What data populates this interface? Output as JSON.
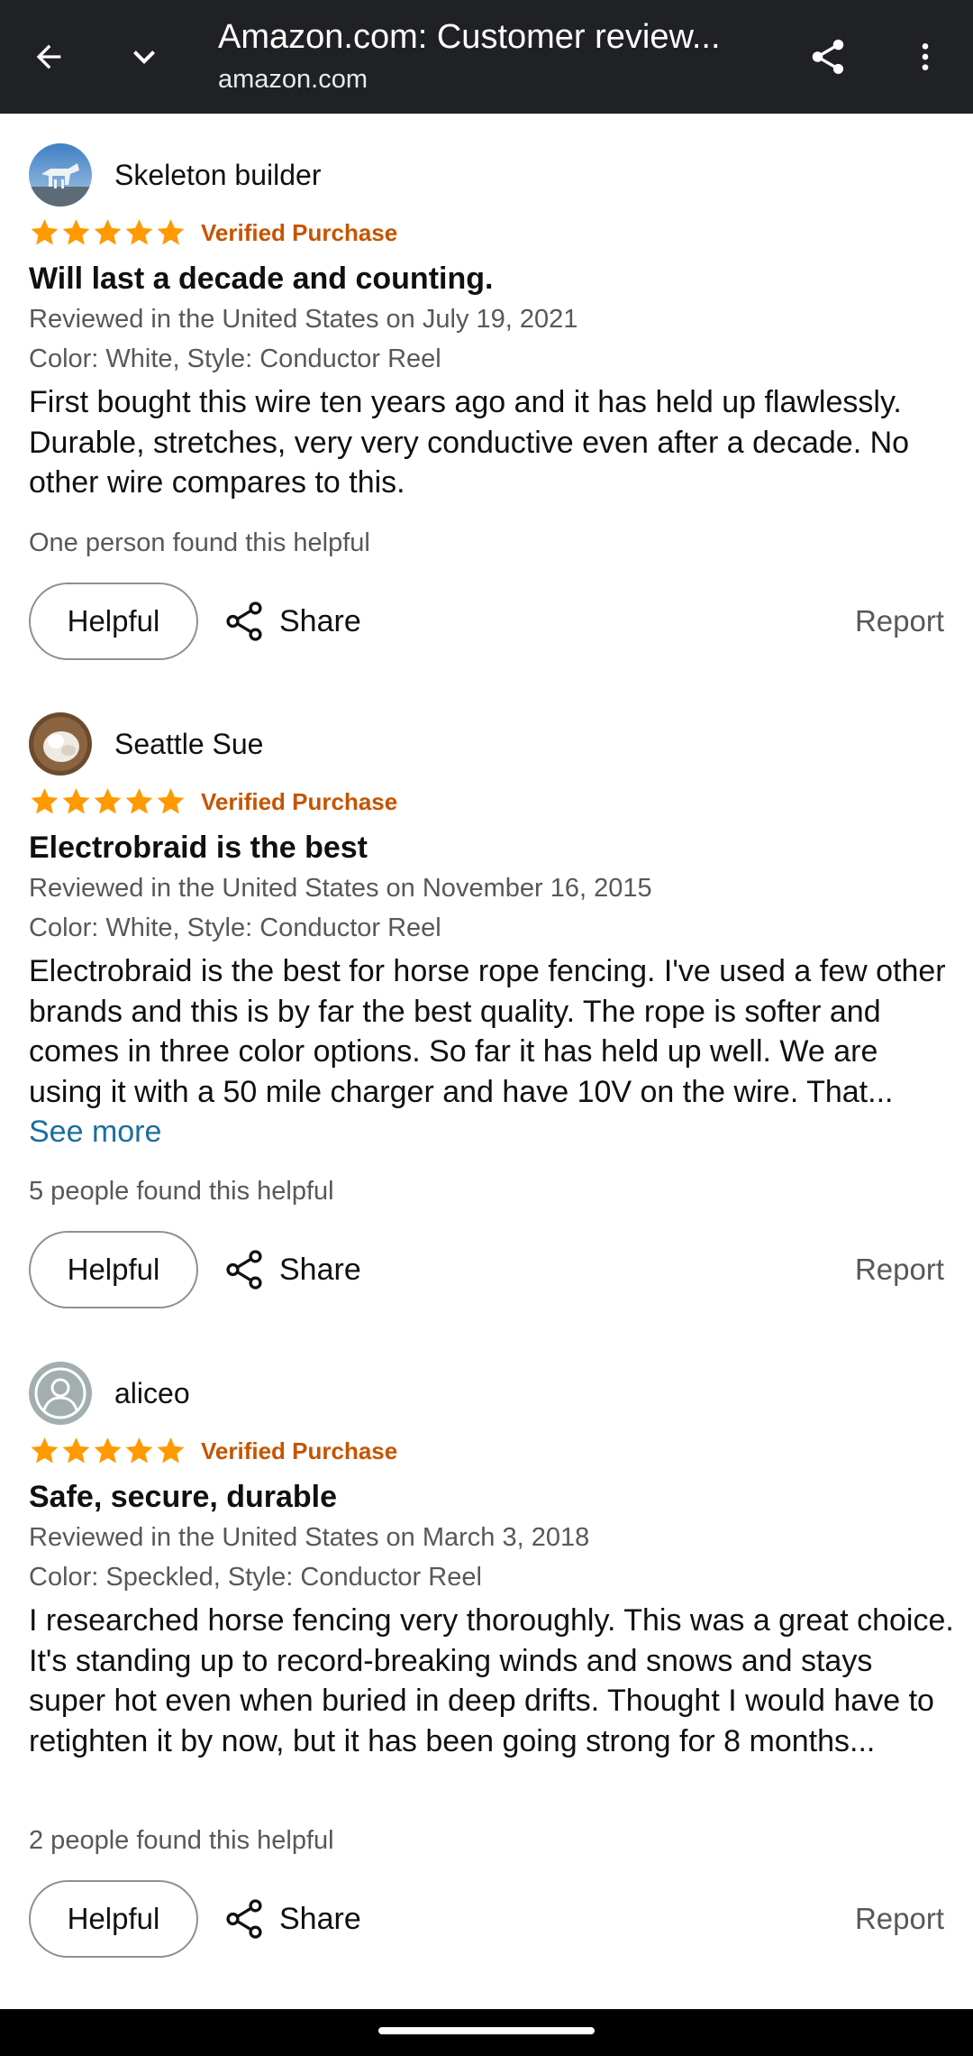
{
  "browser": {
    "title": "Amazon.com: Customer review...",
    "url": "amazon.com",
    "background_color": "#202124"
  },
  "reviews": [
    {
      "author": "Skeleton builder",
      "avatar_icon": "photo-avatar",
      "rating": 5,
      "verified": "Verified Purchase",
      "title": "Will last a decade and counting.",
      "date": "Reviewed in the United States on July 19, 2021",
      "variant": "Color: White, Style: Conductor Reel",
      "body": "First bought this wire ten years ago and it has held up flawlessly. Durable, stretches, very very conductive even after a decade. No other wire compares to this.",
      "see_more": "",
      "helpful_text": "One person found this helpful",
      "helpful_label": "Helpful",
      "share_label": "Share",
      "report_label": "Report"
    },
    {
      "author": "Seattle Sue",
      "avatar_icon": "photo-avatar",
      "rating": 5,
      "verified": "Verified Purchase",
      "title": "Electrobraid is the best",
      "date": "Reviewed in the United States on November 16, 2015",
      "variant": "Color: White, Style: Conductor Reel",
      "body": "Electrobraid is the best for horse rope fencing. I've used a few other brands and this is by far the best quality. The rope is softer and comes in three color options. So far it has held up well. We are using it with a 50 mile charger and have 10V on the wire. That...",
      "see_more": "See more",
      "helpful_text": "5 people found this helpful",
      "helpful_label": "Helpful",
      "share_label": "Share",
      "report_label": "Report"
    },
    {
      "author": "aliceo",
      "avatar_icon": "default-user-avatar",
      "rating": 5,
      "verified": "Verified Purchase",
      "title": "Safe, secure, durable",
      "date": "Reviewed in the United States on March 3, 2018",
      "variant": "Color: Speckled, Style: Conductor Reel",
      "body": "I researched horse fencing very thoroughly. This was a great choice. It's standing up to record-breaking winds and snows and stays super hot even when buried in deep drifts. Thought I would have to retighten it by now, but it has been going strong for 8 months...",
      "see_more": "",
      "helpful_text": "2 people found this helpful",
      "helpful_label": "Helpful",
      "share_label": "Share",
      "report_label": "Report"
    }
  ],
  "colors": {
    "star": "#ff9900",
    "verified": "#c45500",
    "link": "#1a6ea0",
    "secondary_text": "#565959"
  }
}
